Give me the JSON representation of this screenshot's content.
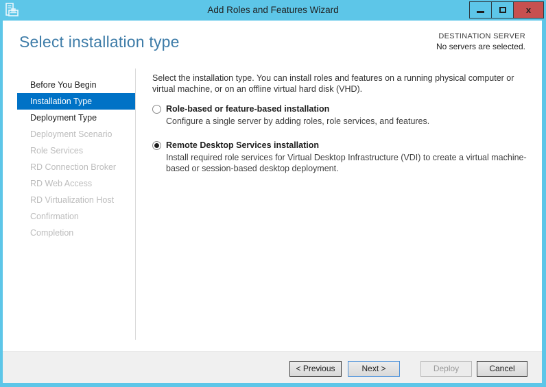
{
  "window": {
    "title": "Add Roles and Features Wizard",
    "app_icon": "server-manager-icon",
    "controls": [
      {
        "name": "minimize-button",
        "icon": "minimize-icon"
      },
      {
        "name": "maximize-button",
        "icon": "maximize-icon"
      },
      {
        "name": "close-button",
        "icon": "close-icon"
      }
    ]
  },
  "header": {
    "page_title": "Select installation type",
    "destination_label": "DESTINATION SERVER",
    "destination_status": "No servers are selected."
  },
  "sidebar": {
    "items": [
      {
        "label": "Before You Begin",
        "state": "enabled"
      },
      {
        "label": "Installation Type",
        "state": "selected"
      },
      {
        "label": "Deployment Type",
        "state": "enabled"
      },
      {
        "label": "Deployment Scenario",
        "state": "disabled"
      },
      {
        "label": "Role Services",
        "state": "disabled"
      },
      {
        "label": "RD Connection Broker",
        "state": "disabled"
      },
      {
        "label": "RD Web Access",
        "state": "disabled"
      },
      {
        "label": "RD Virtualization Host",
        "state": "disabled"
      },
      {
        "label": "Confirmation",
        "state": "disabled"
      },
      {
        "label": "Completion",
        "state": "disabled"
      }
    ]
  },
  "main": {
    "intro": "Select the installation type. You can install roles and features on a running physical computer or virtual machine, or on an offline virtual hard disk (VHD).",
    "options": [
      {
        "label": "Role-based or feature-based installation",
        "description": "Configure a single server by adding roles, role services, and features.",
        "selected": false
      },
      {
        "label": "Remote Desktop Services installation",
        "description": "Install required role services for Virtual Desktop Infrastructure (VDI) to create a virtual machine-based or session-based desktop deployment.",
        "selected": true
      }
    ]
  },
  "footer": {
    "buttons": [
      {
        "label": "< Previous",
        "state": "enabled"
      },
      {
        "label": "Next >",
        "state": "default"
      },
      {
        "label": "Deploy",
        "state": "disabled"
      },
      {
        "label": "Cancel",
        "state": "enabled"
      }
    ]
  },
  "colors": {
    "frame": "#5DC6E8",
    "selected_item": "#0072C6",
    "close_button": "#C75050",
    "heading": "#3E7CA8",
    "footer_bg": "#F0F0F0",
    "default_button_border": "#4A90D9"
  }
}
